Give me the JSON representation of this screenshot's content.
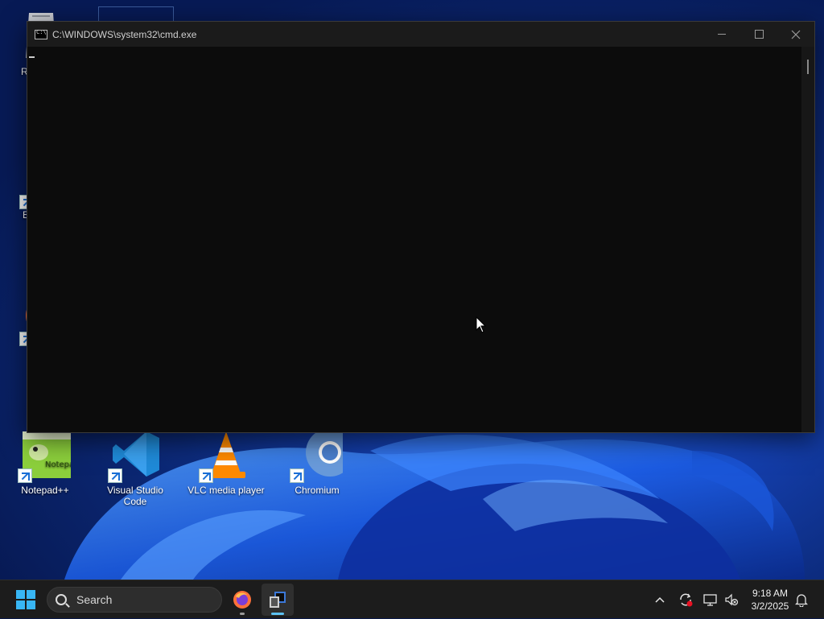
{
  "desktop": {
    "icons": [
      {
        "label": "Notepad++"
      },
      {
        "label": "Visual Studio Code"
      },
      {
        "label": "VLC media player"
      },
      {
        "label": "Chromium"
      }
    ],
    "partial_labels": [
      "R",
      "E"
    ]
  },
  "cmd_window": {
    "title": "C:\\WINDOWS\\system32\\cmd.exe",
    "content": ""
  },
  "taskbar": {
    "search_placeholder": "Search",
    "pinned_apps": [
      "firefox-icon",
      "cmd-icon"
    ],
    "clock": {
      "time": "9:18 AM",
      "date": "3/2/2025"
    }
  },
  "colors": {
    "accent": "#38b6f5",
    "cmd_background": "#0c0c0c",
    "taskbar_background": "#1c1c1c"
  }
}
